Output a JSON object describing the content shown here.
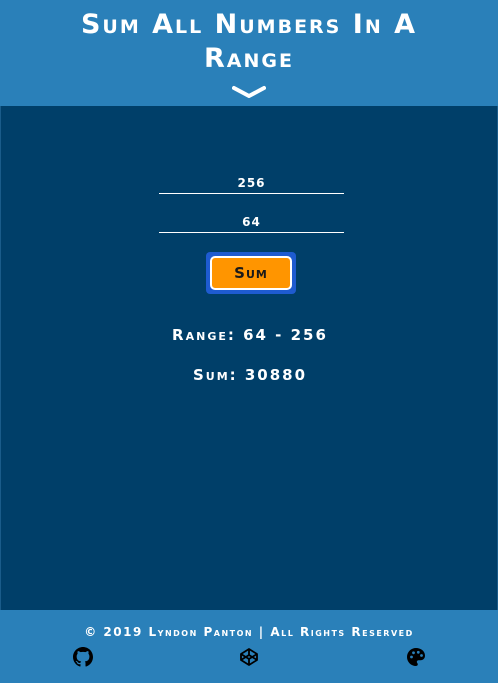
{
  "header": {
    "title": "Sum All Numbers In A Range",
    "chevron_icon": "chevron-down-icon"
  },
  "form": {
    "max_value": "256",
    "min_value": "64",
    "sum_label": "Sum"
  },
  "results": {
    "range_text": "Range: 64 - 256",
    "sum_text": "Sum: 30880"
  },
  "footer": {
    "copyright": "© 2019 Lyndon Panton | All Rights Reserved",
    "icons": [
      "github-icon",
      "codepen-icon",
      "palette-icon"
    ]
  },
  "colors": {
    "header_bg": "#2a80b9",
    "main_bg": "#003f69",
    "button_bg": "#ff9500",
    "button_focus_ring": "#1e5bd0",
    "text": "#ffffff"
  }
}
